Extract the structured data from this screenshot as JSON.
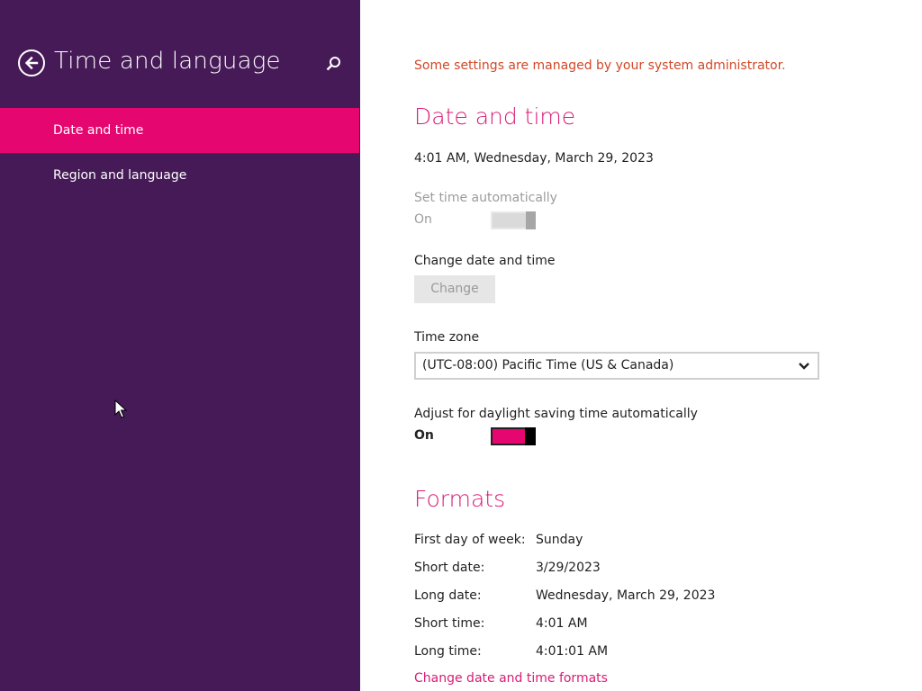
{
  "sidebar": {
    "title": "Time and language",
    "items": [
      {
        "label": "Date and time",
        "selected": true
      },
      {
        "label": "Region and language",
        "selected": false
      }
    ]
  },
  "main": {
    "admin_note": "Some settings are managed by your system administrator.",
    "date_time": {
      "heading": "Date and time",
      "current": "4:01 AM, Wednesday, March 29, 2023",
      "set_auto": {
        "label": "Set time automatically",
        "state": "On",
        "enabled": false
      },
      "change_label": "Change date and time",
      "change_button": "Change",
      "time_zone": {
        "label": "Time zone",
        "value": "(UTC-08:00) Pacific Time (US & Canada)"
      },
      "dst": {
        "label": "Adjust for daylight saving time automatically",
        "state": "On",
        "enabled": true
      }
    },
    "formats": {
      "heading": "Formats",
      "rows": [
        {
          "label": "First day of week:",
          "value": "Sunday"
        },
        {
          "label": "Short date:",
          "value": "3/29/2023"
        },
        {
          "label": "Long date:",
          "value": "Wednesday, March 29, 2023"
        },
        {
          "label": "Short time:",
          "value": "4:01 AM"
        },
        {
          "label": "Long time:",
          "value": "4:01:01 AM"
        }
      ],
      "link": "Change date and time formats"
    }
  },
  "colors": {
    "sidebar_bg": "#451a57",
    "accent": "#e5076f",
    "heading": "#d81c77",
    "warning": "#d24726"
  },
  "icons": [
    "back-arrow-icon",
    "search-icon",
    "chevron-down-icon",
    "mouse-pointer-icon"
  ]
}
